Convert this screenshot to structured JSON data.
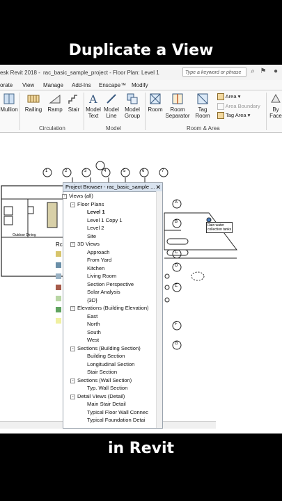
{
  "captions": {
    "top": "Duplicate a View",
    "bottom": "in Revit"
  },
  "window": {
    "app_title": "esk Revit 2018 -",
    "doc_title": "rac_basic_sample_project - Floor Plan: Level 1",
    "search_placeholder": "Type a keyword or phrase"
  },
  "menu": [
    "orate",
    "View",
    "Manage",
    "Add-Ins",
    "Enscape™",
    "Modify"
  ],
  "ribbon": {
    "mullion": "Mullion",
    "railing": "Railing",
    "ramp": "Ramp",
    "stair": "Stair",
    "circulation": "Circulation",
    "model_text": [
      "Model",
      "Text"
    ],
    "model_line": [
      "Model",
      "Line"
    ],
    "model_group": [
      "Model",
      "Group"
    ],
    "model": "Model",
    "room": "Room",
    "room_separator": [
      "Room",
      "Separator"
    ],
    "tag_room": [
      "Tag",
      "Room"
    ],
    "area": "Area",
    "area_boundary": "Area Boundary",
    "tag_area": [
      "Tag",
      "Area"
    ],
    "room_area": "Room & Area",
    "by_face": [
      "By",
      "Face"
    ]
  },
  "grid_labels": [
    "1",
    "2",
    "3",
    "4",
    "5",
    "6",
    "7"
  ],
  "row_labels": [
    "A",
    "B",
    "C",
    "D",
    "E",
    "F",
    "G"
  ],
  "annotations": {
    "rain_water": "Rain water",
    "collection": "collection tanks",
    "outdoor": "Outdoor Dining",
    "rc": "Rc"
  },
  "project_browser": {
    "title": "Project Browser - rac_basic_sample ...",
    "nodes": [
      {
        "label": "Views (all)",
        "level": 0,
        "toggle": "-"
      },
      {
        "label": "Floor Plans",
        "level": 1,
        "toggle": "-"
      },
      {
        "label": "Level 1",
        "level": 2,
        "bold": true
      },
      {
        "label": "Level 1 Copy 1",
        "level": 2
      },
      {
        "label": "Level 2",
        "level": 2
      },
      {
        "label": "Site",
        "level": 2
      },
      {
        "label": "3D Views",
        "level": 1,
        "toggle": "-"
      },
      {
        "label": "Approach",
        "level": 2
      },
      {
        "label": "From Yard",
        "level": 2
      },
      {
        "label": "Kitchen",
        "level": 2
      },
      {
        "label": "Living Room",
        "level": 2
      },
      {
        "label": "Section Perspective",
        "level": 2
      },
      {
        "label": "Solar Analysis",
        "level": 2
      },
      {
        "label": "{3D}",
        "level": 2
      },
      {
        "label": "Elevations (Building Elevation)",
        "level": 1,
        "toggle": "-"
      },
      {
        "label": "East",
        "level": 2
      },
      {
        "label": "North",
        "level": 2
      },
      {
        "label": "South",
        "level": 2
      },
      {
        "label": "West",
        "level": 2
      },
      {
        "label": "Sections (Building Section)",
        "level": 1,
        "toggle": "-"
      },
      {
        "label": "Building Section",
        "level": 2
      },
      {
        "label": "Longitudinal Section",
        "level": 2
      },
      {
        "label": "Stair Section",
        "level": 2
      },
      {
        "label": "Sections (Wall Section)",
        "level": 1,
        "toggle": "-"
      },
      {
        "label": "Typ. Wall Section",
        "level": 2
      },
      {
        "label": "Detail Views (Detail)",
        "level": 1,
        "toggle": "-"
      },
      {
        "label": "Main Stair Detail",
        "level": 2
      },
      {
        "label": "Typical Floor Wall Connec",
        "level": 2
      },
      {
        "label": "Typical Foundation Detai",
        "level": 2
      }
    ]
  },
  "colors": {
    "background": "#000000",
    "caption": "#ffffff",
    "accent": "#3a6fb0"
  }
}
